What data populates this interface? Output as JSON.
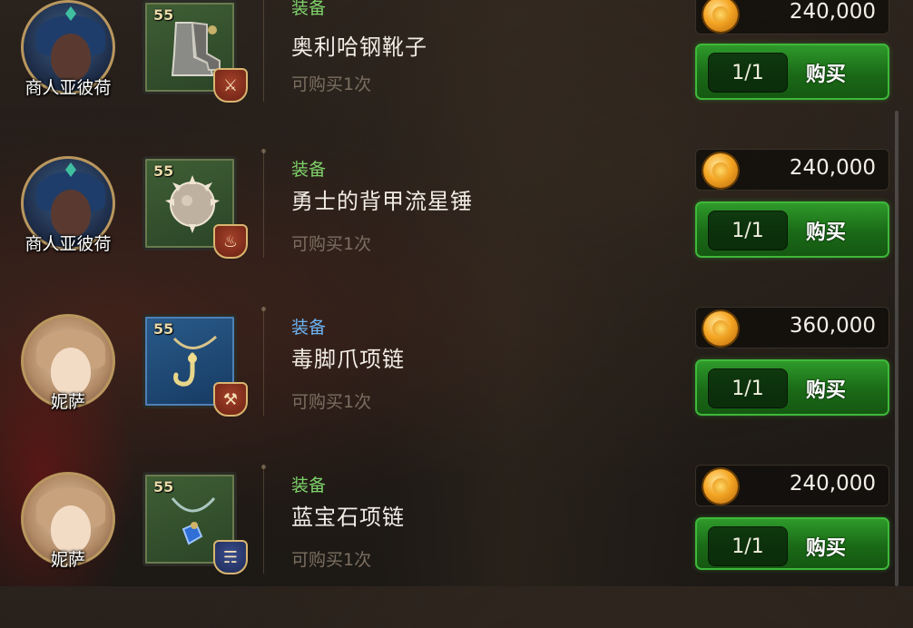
{
  "currency_icon": "gold-coin-icon",
  "colors": {
    "category_green": "#7ed36a",
    "category_blue": "#6cb4f5",
    "buy_button": "#2e9a2a"
  },
  "rows": [
    {
      "npc_name": "商人亚彼荷",
      "item_level": "55",
      "category": "装备",
      "category_color": "#7ed36a",
      "item_name": "奥利哈钢靴子",
      "purchase_limit": "可购买1次",
      "price": "240,000",
      "count": "1/1",
      "buy_label": "购买",
      "item_icon": "steel-boots-icon",
      "class_icon": "sword-class-icon"
    },
    {
      "npc_name": "商人亚彼荷",
      "item_level": "55",
      "category": "装备",
      "category_color": "#7ed36a",
      "item_name": "勇士的背甲流星锤",
      "purchase_limit": "可购买1次",
      "price": "240,000",
      "count": "1/1",
      "buy_label": "购买",
      "item_icon": "spiked-mace-icon",
      "class_icon": "fire-class-icon"
    },
    {
      "npc_name": "妮萨",
      "item_level": "55",
      "category": "装备",
      "category_color": "#6cb4f5",
      "item_name": "毒脚爪项链",
      "purchase_limit": "可购买1次",
      "price": "360,000",
      "count": "1/1",
      "buy_label": "购买",
      "item_icon": "hook-necklace-icon",
      "class_icon": "trident-class-icon"
    },
    {
      "npc_name": "妮萨",
      "item_level": "55",
      "category": "装备",
      "category_color": "#7ed36a",
      "item_name": "蓝宝石项链",
      "purchase_limit": "可购买1次",
      "price": "240,000",
      "count": "1/1",
      "buy_label": "购买",
      "item_icon": "sapphire-necklace-icon",
      "class_icon": "scroll-class-icon"
    }
  ]
}
